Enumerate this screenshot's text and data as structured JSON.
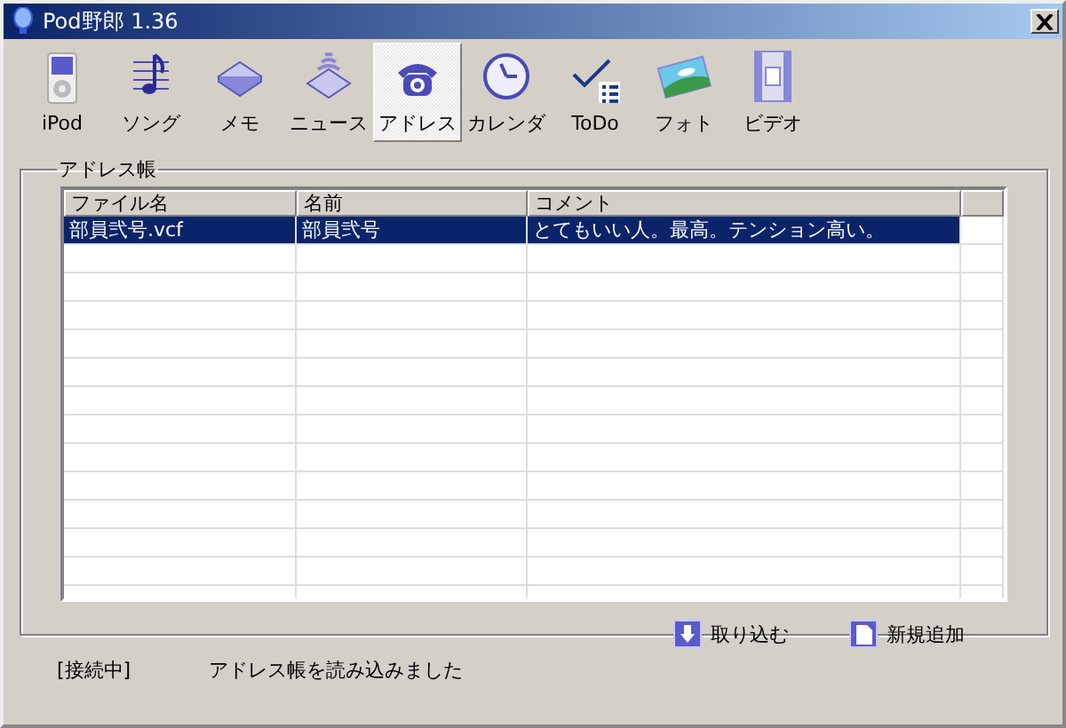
{
  "window": {
    "title": "Pod野郎 1.36"
  },
  "toolbar": [
    {
      "kind": "ipod",
      "label": "iPod",
      "selected": false
    },
    {
      "kind": "song",
      "label": "ソング",
      "selected": false
    },
    {
      "kind": "memo",
      "label": "メモ",
      "selected": false
    },
    {
      "kind": "news",
      "label": "ニュース",
      "selected": false
    },
    {
      "kind": "address",
      "label": "アドレス",
      "selected": true
    },
    {
      "kind": "calendar",
      "label": "カレンダ",
      "selected": false
    },
    {
      "kind": "todo",
      "label": "ToDo",
      "selected": false
    },
    {
      "kind": "photo",
      "label": "フォト",
      "selected": false
    },
    {
      "kind": "video",
      "label": "ビデオ",
      "selected": false
    }
  ],
  "group": {
    "title": "アドレス帳"
  },
  "table": {
    "columns": [
      "ファイル名",
      "名前",
      "コメント"
    ],
    "rows": [
      {
        "cells": [
          "部員弐号.vcf",
          "部員弐号",
          "とてもいい人。最高。テンション高い。"
        ],
        "selected": true
      }
    ]
  },
  "buttons": [
    {
      "kind": "import",
      "label": "取り込む"
    },
    {
      "kind": "new",
      "label": "新規追加"
    }
  ],
  "status_bar": {
    "connection": "[接続中]",
    "message": "アドレス帳を読み込みました"
  }
}
